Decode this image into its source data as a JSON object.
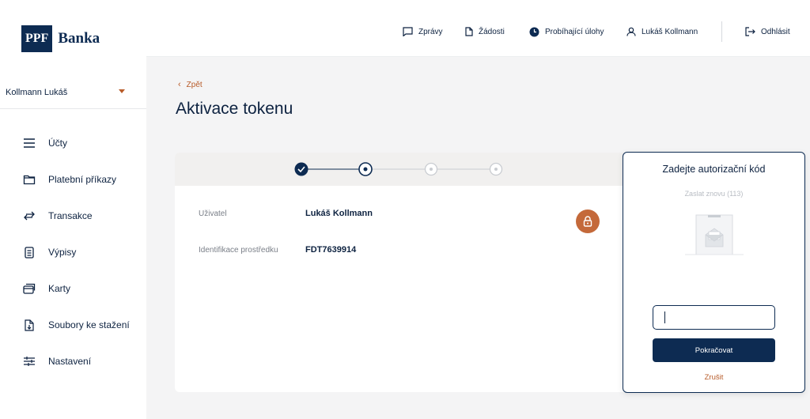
{
  "brand": {
    "logo_box": "PPF",
    "logo_text": "Banka"
  },
  "user_select": {
    "label": "Kollmann Lukáš"
  },
  "sidebar": {
    "items": [
      {
        "label": "Účty",
        "icon": "menu-lines-icon"
      },
      {
        "label": "Platební příkazy",
        "icon": "folder-icon"
      },
      {
        "label": "Transakce",
        "icon": "transfer-arrows-icon"
      },
      {
        "label": "Výpisy",
        "icon": "document-icon"
      },
      {
        "label": "Karty",
        "icon": "cards-icon"
      },
      {
        "label": "Soubory ke stažení",
        "icon": "file-download-icon"
      },
      {
        "label": "Nastavení",
        "icon": "sliders-icon"
      }
    ]
  },
  "topbar": {
    "messages": "Zprávy",
    "requests": "Žádosti",
    "tasks": "Probíhající úlohy",
    "user": "Lukáš Kollmann",
    "logout": "Odhlásit"
  },
  "page": {
    "back": "Zpět",
    "title": "Aktivace tokenu"
  },
  "stepper": {
    "total_steps": 4,
    "completed": 1,
    "current": 2
  },
  "details": {
    "user_label": "Uživatel",
    "user_value": "Lukáš Kollmann",
    "device_label": "Identifikace prostředku",
    "device_value": "FDT7639914"
  },
  "auth": {
    "title": "Zadejte autorizační kód",
    "resend": "Zaslat znovu (113)",
    "code_value": "",
    "continue": "Pokračovat",
    "cancel": "Zrušit"
  },
  "colors": {
    "navy": "#0d2b52",
    "accent": "#c4693a",
    "background": "#f4f4f5"
  }
}
